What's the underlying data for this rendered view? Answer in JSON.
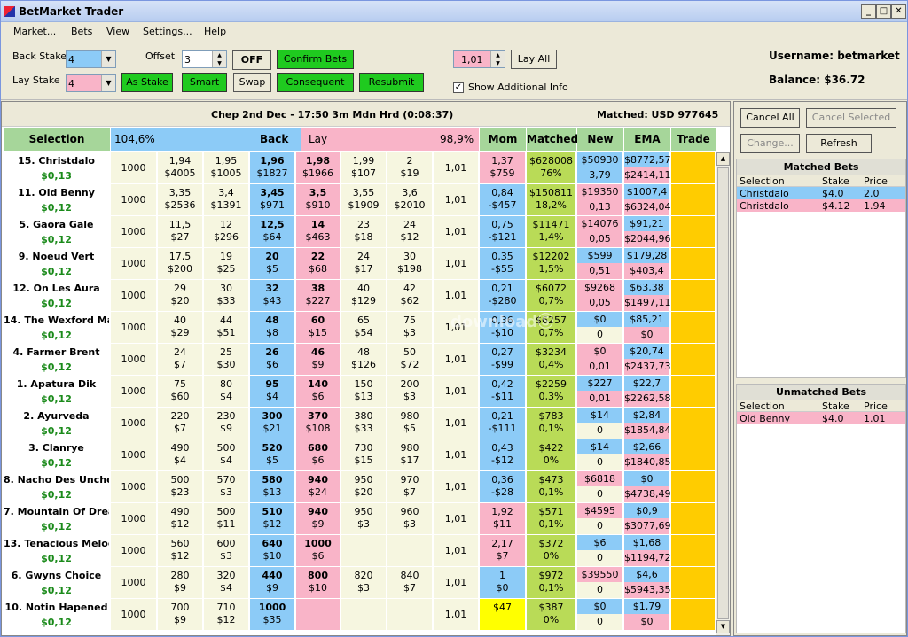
{
  "window": {
    "title": "BetMarket Trader"
  },
  "menu": [
    "Market...",
    "Bets",
    "View",
    "Settings...",
    "Help"
  ],
  "toolbar": {
    "back_stake_label": "Back Stake",
    "lay_stake_label": "Lay Stake",
    "back_stake_value": "4",
    "lay_stake_value": "4",
    "offset_label": "Offset",
    "offset_value": "3",
    "off_label": "OFF",
    "confirm_bets": "Confirm Bets",
    "as_stake": "As Stake",
    "smart": "Smart",
    "swap": "Swap",
    "consequent": "Consequent",
    "resubmit": "Resubmit",
    "price_value": "1,01",
    "lay_all": "Lay All",
    "show_info": "Show Additional Info"
  },
  "account": {
    "username": "Username: betmarket",
    "balance": "Balance: $36.72"
  },
  "race": {
    "title": "Chep 2nd Dec - 17:50 3m Mdn Hrd (0:08:37)",
    "matched": "Matched: USD 977645"
  },
  "columns": {
    "selection": "Selection",
    "back_pct": "104,6%",
    "back": "Back",
    "lay": "Lay",
    "lay_pct": "98,9%",
    "mom": "Mom",
    "matched": "Matched",
    "new": "New",
    "ema": "EMA",
    "trade": "Trade"
  },
  "runners": [
    {
      "name": "15. Christdalo",
      "profit": "$0,13",
      "stake": "1000",
      "b3": [
        "1,94",
        "$4005"
      ],
      "b2": [
        "1,95",
        "$1005"
      ],
      "b1": [
        "1,96",
        "$1827"
      ],
      "l1": [
        "1,98",
        "$1966"
      ],
      "l2": [
        "1,99",
        "$107"
      ],
      "l3": [
        "2",
        "$19"
      ],
      "price": "1,01",
      "mom": [
        "1,37",
        "$759"
      ],
      "mom_c": "lay",
      "mt": [
        "$628008",
        "76%"
      ],
      "nw": [
        "$50930",
        "3,79"
      ],
      "nw_c": [
        "back",
        "back"
      ],
      "ema": [
        "$8772,57",
        "$2414,11"
      ],
      "ema_c": [
        "back",
        "lay"
      ]
    },
    {
      "name": "11. Old Benny",
      "profit": "$0,12",
      "stake": "1000",
      "b3": [
        "3,35",
        "$2536"
      ],
      "b2": [
        "3,4",
        "$1391"
      ],
      "b1": [
        "3,45",
        "$971"
      ],
      "l1": [
        "3,5",
        "$910"
      ],
      "l2": [
        "3,55",
        "$1909"
      ],
      "l3": [
        "3,6",
        "$2010"
      ],
      "price": "1,01",
      "mom": [
        "0,84",
        "-$457"
      ],
      "mom_c": "back",
      "mt": [
        "$150811",
        "18,2%"
      ],
      "nw": [
        "$19350",
        "0,13"
      ],
      "nw_c": [
        "lay",
        "lay"
      ],
      "ema": [
        "$1007,4",
        "$6324,04"
      ],
      "ema_c": [
        "back",
        "lay"
      ]
    },
    {
      "name": "5. Gaora Gale",
      "profit": "$0,12",
      "stake": "1000",
      "b3": [
        "11,5",
        "$27"
      ],
      "b2": [
        "12",
        "$296"
      ],
      "b1": [
        "12,5",
        "$64"
      ],
      "l1": [
        "14",
        "$463"
      ],
      "l2": [
        "23",
        "$18"
      ],
      "l3": [
        "24",
        "$12"
      ],
      "price": "1,01",
      "mom": [
        "0,75",
        "-$121"
      ],
      "mom_c": "back",
      "mt": [
        "$11471",
        "1,4%"
      ],
      "nw": [
        "$14076",
        "0,05"
      ],
      "nw_c": [
        "lay",
        "lay"
      ],
      "ema": [
        "$91,21",
        "$2044,96"
      ],
      "ema_c": [
        "back",
        "lay"
      ]
    },
    {
      "name": "9. Noeud Vert",
      "profit": "$0,12",
      "stake": "1000",
      "b3": [
        "17,5",
        "$200"
      ],
      "b2": [
        "19",
        "$25"
      ],
      "b1": [
        "20",
        "$5"
      ],
      "l1": [
        "22",
        "$68"
      ],
      "l2": [
        "24",
        "$17"
      ],
      "l3": [
        "30",
        "$198"
      ],
      "price": "1,01",
      "mom": [
        "0,35",
        "-$55"
      ],
      "mom_c": "back",
      "mt": [
        "$12202",
        "1,5%"
      ],
      "nw": [
        "$599",
        "0,51"
      ],
      "nw_c": [
        "back",
        "lay"
      ],
      "ema": [
        "$179,28",
        "$403,4"
      ],
      "ema_c": [
        "back",
        "lay"
      ]
    },
    {
      "name": "12. On Les Aura",
      "profit": "$0,12",
      "stake": "1000",
      "b3": [
        "29",
        "$20"
      ],
      "b2": [
        "30",
        "$33"
      ],
      "b1": [
        "32",
        "$43"
      ],
      "l1": [
        "38",
        "$227"
      ],
      "l2": [
        "40",
        "$129"
      ],
      "l3": [
        "42",
        "$62"
      ],
      "price": "1,01",
      "mom": [
        "0,21",
        "-$280"
      ],
      "mom_c": "back",
      "mt": [
        "$6072",
        "0,7%"
      ],
      "nw": [
        "$9268",
        "0,05"
      ],
      "nw_c": [
        "lay",
        "lay"
      ],
      "ema": [
        "$63,38",
        "$1497,11"
      ],
      "ema_c": [
        "back",
        "lay"
      ]
    },
    {
      "name": "14. The Wexford Ma",
      "profit": "$0,12",
      "stake": "1000",
      "b3": [
        "40",
        "$29"
      ],
      "b2": [
        "44",
        "$51"
      ],
      "b1": [
        "48",
        "$8"
      ],
      "l1": [
        "60",
        "$15"
      ],
      "l2": [
        "65",
        "$54"
      ],
      "l3": [
        "75",
        "$3"
      ],
      "price": "1,01",
      "mom": [
        "0,36",
        "-$10"
      ],
      "mom_c": "back",
      "mt": [
        "$6257",
        "0,7%"
      ],
      "nw": [
        "$0",
        "0"
      ],
      "nw_c": [
        "back",
        "none"
      ],
      "ema": [
        "$85,21",
        "$0"
      ],
      "ema_c": [
        "back",
        "lay"
      ]
    },
    {
      "name": "4. Farmer Brent",
      "profit": "$0,12",
      "stake": "1000",
      "b3": [
        "24",
        "$7"
      ],
      "b2": [
        "25",
        "$30"
      ],
      "b1": [
        "26",
        "$6"
      ],
      "l1": [
        "46",
        "$9"
      ],
      "l2": [
        "48",
        "$126"
      ],
      "l3": [
        "50",
        "$72"
      ],
      "price": "1,01",
      "mom": [
        "0,27",
        "-$99"
      ],
      "mom_c": "back",
      "mt": [
        "$3234",
        "0,4%"
      ],
      "nw": [
        "$0",
        "0,01"
      ],
      "nw_c": [
        "lay",
        "lay"
      ],
      "ema": [
        "$20,74",
        "$2437,73"
      ],
      "ema_c": [
        "back",
        "lay"
      ]
    },
    {
      "name": "1. Apatura Dik",
      "profit": "$0,12",
      "stake": "1000",
      "b3": [
        "75",
        "$60"
      ],
      "b2": [
        "80",
        "$4"
      ],
      "b1": [
        "95",
        "$4"
      ],
      "l1": [
        "140",
        "$6"
      ],
      "l2": [
        "150",
        "$13"
      ],
      "l3": [
        "200",
        "$3"
      ],
      "price": "1,01",
      "mom": [
        "0,42",
        "-$11"
      ],
      "mom_c": "back",
      "mt": [
        "$2259",
        "0,3%"
      ],
      "nw": [
        "$227",
        "0,01"
      ],
      "nw_c": [
        "back",
        "lay"
      ],
      "ema": [
        "$22,7",
        "$2262,58"
      ],
      "ema_c": [
        "back",
        "lay"
      ]
    },
    {
      "name": "2. Ayurveda",
      "profit": "$0,12",
      "stake": "1000",
      "b3": [
        "220",
        "$7"
      ],
      "b2": [
        "230",
        "$9"
      ],
      "b1": [
        "300",
        "$21"
      ],
      "l1": [
        "370",
        "$108"
      ],
      "l2": [
        "380",
        "$33"
      ],
      "l3": [
        "980",
        "$5"
      ],
      "price": "1,01",
      "mom": [
        "0,21",
        "-$111"
      ],
      "mom_c": "back",
      "mt": [
        "$783",
        "0,1%"
      ],
      "nw": [
        "$14",
        "0"
      ],
      "nw_c": [
        "back",
        "none"
      ],
      "ema": [
        "$2,84",
        "$1854,84"
      ],
      "ema_c": [
        "back",
        "lay"
      ]
    },
    {
      "name": "3. Clanrye",
      "profit": "$0,12",
      "stake": "1000",
      "b3": [
        "490",
        "$4"
      ],
      "b2": [
        "500",
        "$4"
      ],
      "b1": [
        "520",
        "$5"
      ],
      "l1": [
        "680",
        "$6"
      ],
      "l2": [
        "730",
        "$15"
      ],
      "l3": [
        "980",
        "$17"
      ],
      "price": "1,01",
      "mom": [
        "0,43",
        "-$12"
      ],
      "mom_c": "back",
      "mt": [
        "$422",
        "0%"
      ],
      "nw": [
        "$14",
        "0"
      ],
      "nw_c": [
        "back",
        "none"
      ],
      "ema": [
        "$2,66",
        "$1840,85"
      ],
      "ema_c": [
        "back",
        "lay"
      ]
    },
    {
      "name": "8. Nacho Des Unche",
      "profit": "$0,12",
      "stake": "1000",
      "b3": [
        "500",
        "$23"
      ],
      "b2": [
        "570",
        "$3"
      ],
      "b1": [
        "580",
        "$13"
      ],
      "l1": [
        "940",
        "$24"
      ],
      "l2": [
        "950",
        "$20"
      ],
      "l3": [
        "970",
        "$7"
      ],
      "price": "1,01",
      "mom": [
        "0,36",
        "-$28"
      ],
      "mom_c": "back",
      "mt": [
        "$473",
        "0,1%"
      ],
      "nw": [
        "$6818",
        "0"
      ],
      "nw_c": [
        "lay",
        "none"
      ],
      "ema": [
        "$0",
        "$4738,49"
      ],
      "ema_c": [
        "back",
        "lay"
      ]
    },
    {
      "name": "7. Mountain Of Drea",
      "profit": "$0,12",
      "stake": "1000",
      "b3": [
        "490",
        "$12"
      ],
      "b2": [
        "500",
        "$11"
      ],
      "b1": [
        "510",
        "$12"
      ],
      "l1": [
        "940",
        "$9"
      ],
      "l2": [
        "950",
        "$3"
      ],
      "l3": [
        "960",
        "$3"
      ],
      "price": "1,01",
      "mom": [
        "1,92",
        "$11"
      ],
      "mom_c": "lay",
      "mt": [
        "$571",
        "0,1%"
      ],
      "nw": [
        "$4595",
        "0"
      ],
      "nw_c": [
        "lay",
        "none"
      ],
      "ema": [
        "$0,9",
        "$3077,69"
      ],
      "ema_c": [
        "back",
        "lay"
      ]
    },
    {
      "name": "13. Tenacious Melod",
      "profit": "$0,12",
      "stake": "1000",
      "b3": [
        "560",
        "$12"
      ],
      "b2": [
        "600",
        "$3"
      ],
      "b1": [
        "640",
        "$10"
      ],
      "l1": [
        "1000",
        "$6"
      ],
      "l2": [
        "",
        ""
      ],
      "l3": [
        "",
        ""
      ],
      "price": "1,01",
      "mom": [
        "2,17",
        "$7"
      ],
      "mom_c": "lay",
      "mt": [
        "$372",
        "0%"
      ],
      "nw": [
        "$6",
        "0"
      ],
      "nw_c": [
        "back",
        "none"
      ],
      "ema": [
        "$1,68",
        "$1194,72"
      ],
      "ema_c": [
        "back",
        "lay"
      ]
    },
    {
      "name": "6. Gwyns Choice",
      "profit": "$0,12",
      "stake": "1000",
      "b3": [
        "280",
        "$9"
      ],
      "b2": [
        "320",
        "$4"
      ],
      "b1": [
        "440",
        "$9"
      ],
      "l1": [
        "800",
        "$10"
      ],
      "l2": [
        "820",
        "$3"
      ],
      "l3": [
        "840",
        "$7"
      ],
      "price": "1,01",
      "mom": [
        "1",
        "$0"
      ],
      "mom_c": "back",
      "mt": [
        "$972",
        "0,1%"
      ],
      "nw": [
        "$39550",
        "0"
      ],
      "nw_c": [
        "lay",
        "none"
      ],
      "ema": [
        "$4,6",
        "$5943,35"
      ],
      "ema_c": [
        "back",
        "lay"
      ]
    },
    {
      "name": "10. Notin Hapened",
      "profit": "$0,12",
      "stake": "1000",
      "b3": [
        "700",
        "$9"
      ],
      "b2": [
        "710",
        "$12"
      ],
      "b1": [
        "1000",
        "$35"
      ],
      "l1": [
        "",
        ""
      ],
      "l2": [
        "",
        ""
      ],
      "l3": [
        "",
        ""
      ],
      "price": "1,01",
      "mom": [
        "",
        "$47"
      ],
      "mom_c": "yellow",
      "mt": [
        "$387",
        "0%"
      ],
      "nw": [
        "$0",
        "0"
      ],
      "nw_c": [
        "back",
        "none"
      ],
      "ema": [
        "$1,79",
        "$0"
      ],
      "ema_c": [
        "back",
        "lay"
      ]
    }
  ],
  "right": {
    "cancel_all": "Cancel All",
    "cancel_selected": "Cancel Selected",
    "change": "Change...",
    "refresh": "Refresh",
    "matched_title": "Matched Bets",
    "unmatched_title": "Unmatched Bets",
    "headers": [
      "Selection",
      "Stake",
      "Price"
    ],
    "matched": [
      {
        "sel": "Christdalo",
        "stake": "$4.0",
        "price": "2.0",
        "type": "back"
      },
      {
        "sel": "Christdalo",
        "stake": "$4.12",
        "price": "1.94",
        "type": "lay"
      }
    ],
    "unmatched": [
      {
        "sel": "Old Benny",
        "stake": "$4.0",
        "price": "1.01",
        "type": "lay"
      }
    ]
  },
  "colors": {
    "back": "#8ccbf7",
    "lay": "#f9b4c8",
    "green": "#b9db57",
    "cream": "#f6f6e0",
    "yellow": "#ffcc00",
    "bright_yellow": "#ffff00",
    "header_green": "#a6d69a"
  },
  "watermark": "downloadⓈ"
}
